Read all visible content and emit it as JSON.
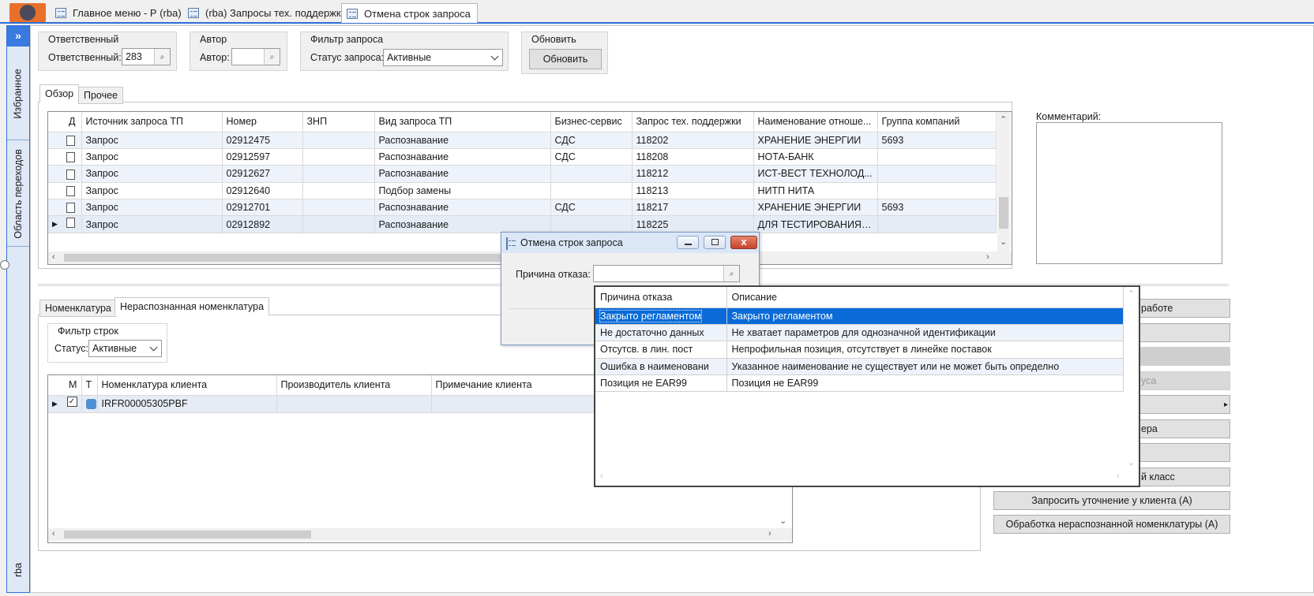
{
  "tabs": [
    {
      "label": "Главное меню  -  Р (rba)"
    },
    {
      "label": "(rba) Запросы тех. поддержки"
    },
    {
      "label": "Отмена строк запроса"
    }
  ],
  "sidebar": {
    "expand": "»",
    "items": [
      {
        "label": "Избранное"
      },
      {
        "label": "Область переходов"
      }
    ],
    "footer": "rba"
  },
  "filters": {
    "responsible_group": "Ответственный",
    "responsible_label": "Ответственный:",
    "responsible_value": "283",
    "author_group": "Автор",
    "author_label": "Автор:",
    "author_value": "",
    "request_filter_group": "Фильтр запроса",
    "status_label": "Статус запроса:",
    "status_value": "Активные",
    "refresh_group": "Обновить",
    "refresh_button": "Обновить"
  },
  "upper_tabs": [
    {
      "label": "Обзор"
    },
    {
      "label": "Прочее"
    }
  ],
  "requests_grid": {
    "columns": [
      "Д",
      "Источник запроса ТП",
      "Номер",
      "ЗНП",
      "Вид запроса ТП",
      "Бизнес-сервис",
      "Запрос тех. поддержки",
      "Наименование отноше...",
      "Группа компаний"
    ],
    "rows": [
      {
        "source": "Запрос",
        "number": "02912475",
        "znp": "",
        "type": "Распознавание",
        "service": "СДС",
        "ticket": "118202",
        "name": "ХРАНЕНИЕ ЭНЕРГИИ",
        "group": "5693"
      },
      {
        "source": "Запрос",
        "number": "02912597",
        "znp": "",
        "type": "Распознавание",
        "service": "СДС",
        "ticket": "118208",
        "name": "НОТА-БАНК",
        "group": ""
      },
      {
        "source": "Запрос",
        "number": "02912627",
        "znp": "",
        "type": "Распознавание",
        "service": "",
        "ticket": "118212",
        "name": "ИСТ-ВЕСТ ТЕХНОЛОД...",
        "group": ""
      },
      {
        "source": "Запрос",
        "number": "02912640",
        "znp": "",
        "type": "Подбор замены",
        "service": "",
        "ticket": "118213",
        "name": "НИТП НИТА",
        "group": ""
      },
      {
        "source": "Запрос",
        "number": "02912701",
        "znp": "",
        "type": "Распознавание",
        "service": "СДС",
        "ticket": "118217",
        "name": "ХРАНЕНИЕ ЭНЕРГИИ",
        "group": "5693"
      },
      {
        "source": "Запрос",
        "number": "02912892",
        "znp": "",
        "type": "Распознавание",
        "service": "",
        "ticket": "118225",
        "name": "ДЛЯ ТЕСТИРОВАНИЯ К...",
        "group": ""
      }
    ]
  },
  "comment_label": "Комментарий:",
  "lower_tabs": [
    {
      "label": "Номенклатура"
    },
    {
      "label": "Нераспознанная номенклатура"
    }
  ],
  "row_filter": {
    "group": "Фильтр строк",
    "status_label": "Статус:",
    "status_value": "Активные"
  },
  "items_grid": {
    "columns": [
      "М",
      "Т",
      "Номенклатура клиента",
      "Производитель клиента",
      "Примечание клиента"
    ],
    "rows": [
      {
        "item": "IRFR00005305PBF",
        "maker": "",
        "note": ""
      }
    ]
  },
  "right_buttons": [
    {
      "label": "работе"
    },
    {
      "label": ""
    },
    {
      "label": ""
    },
    {
      "label": "уса"
    },
    {
      "label": "▸"
    },
    {
      "label": "ера"
    },
    {
      "label": ""
    },
    {
      "label": "й класс"
    },
    {
      "label": "Запросить уточнение у клиента (А)"
    },
    {
      "label": "Обработка нераспознанной номенклатуры (А)"
    }
  ],
  "dialog": {
    "title": "Отмена строк запроса",
    "reason_label": "Причина отказа:",
    "reason_value": "",
    "close": "x"
  },
  "reason_dropdown": {
    "columns": [
      "Причина отказа",
      "Описание"
    ],
    "rows": [
      {
        "reason": "Закрыто регламентом",
        "description": "Закрыто регламентом"
      },
      {
        "reason": "Не достаточно данных",
        "description": "Не хватает параметров для однозначной идентификации"
      },
      {
        "reason": "Отсутсв. в лин. пост",
        "description": "Непрофильная позиция, отсутствует в линейке поставок"
      },
      {
        "reason": "Ошибка в наименовани",
        "description": "Указанное наименование не существует или не может быть определно"
      },
      {
        "reason": "Позиция не EAR99",
        "description": "Позиция не EAR99"
      }
    ]
  },
  "colors": {
    "accent": "#2f6fd6",
    "selection": "#0a6bd8",
    "app_icon": "#e8702a"
  }
}
